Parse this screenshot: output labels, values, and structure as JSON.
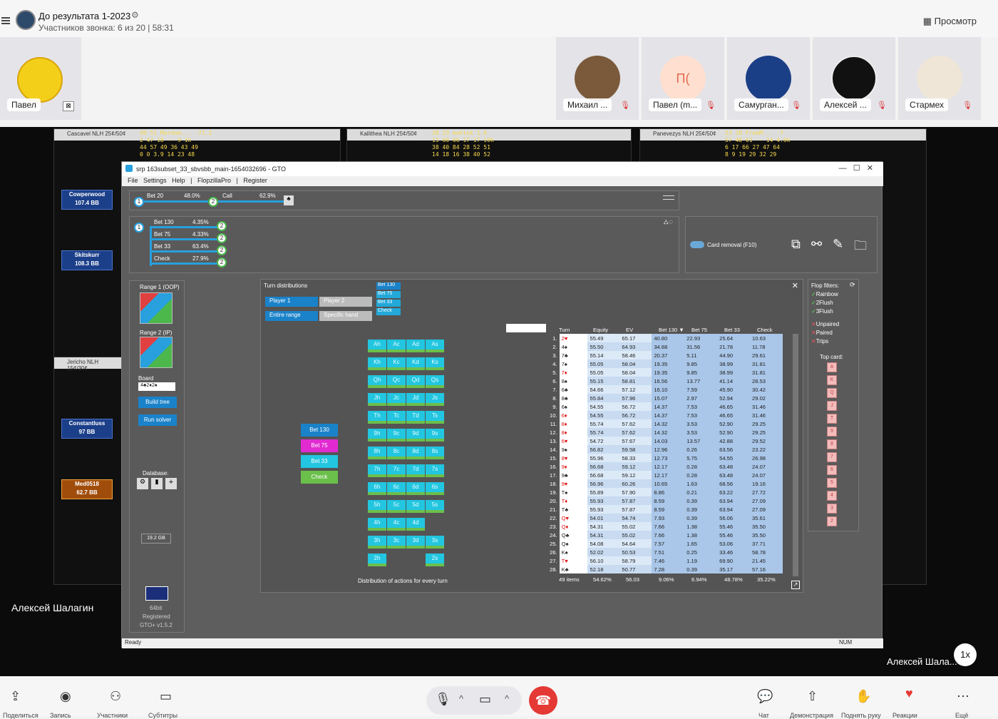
{
  "call": {
    "title": "До результата 1-2023",
    "subtitle": "Участников звонка: 6 из 20 | 58:31",
    "view_label": "Просмотр",
    "self_name": "Павел",
    "participants": [
      {
        "name": "Михаил ...",
        "avatar_text": ""
      },
      {
        "name": "Павел (m...",
        "avatar_text": "П("
      },
      {
        "name": "Самурган...",
        "avatar_text": ""
      },
      {
        "name": "Алексей ...",
        "avatar_text": ""
      },
      {
        "name": "Стармех",
        "avatar_text": ""
      }
    ],
    "presenter": "Алексей Шалагин",
    "presenter_short": "Алексей Шала...",
    "speed_label": "1x"
  },
  "bg_tables": [
    {
      "title": "Cascavel NLH 25¢/50¢",
      "hud": "49 51 Mardum... -71.2\n2 47 18 -- 9 1k\n44 57 49 36 43 49\n0 0 3.9 14 23 48"
    },
    {
      "title": "Kallithea NLH 25¢/50¢",
      "hud": "28 23 moklok 1.6\n13 66 66 17 17 10k\n38 40 84 28 52 51\n14 18 16 38 40 52"
    },
    {
      "title": "Panevezys NLH 25¢/50¢",
      "hud": "23 18 FreeM... -7\n57 48 61 -- 14 4.6k\n6 17 66 27 47 64\n8 9 19 29 32 29"
    },
    {
      "title": "Jericho NLH 15¢/30¢",
      "hud": ""
    }
  ],
  "bg_players": [
    {
      "name": "Cowperwood",
      "stack": "107.4 BB"
    },
    {
      "name": "Skitskurr",
      "stack": "108.3 BB"
    },
    {
      "name": "Constantluss",
      "stack": "97 BB"
    },
    {
      "name": "Med0518",
      "stack": "62.7 BB"
    }
  ],
  "gto": {
    "window_title": "srp 163subset_33_sbvsbb_main-1654032696 - GTO",
    "menu": [
      "File",
      "Settings",
      "Help",
      "|",
      "FlopzillaPro",
      "|",
      "Register"
    ],
    "line_actions": [
      {
        "label": "Bet 20",
        "pct": "48.0%"
      },
      {
        "label": "Call",
        "pct": "62.9%"
      }
    ],
    "tree_actions": [
      {
        "label": "Bet 130",
        "pct": "4.35%"
      },
      {
        "label": "Bet 75",
        "pct": "4.33%"
      },
      {
        "label": "Bet 33",
        "pct": "63.4%"
      },
      {
        "label": "Check",
        "pct": "27.9%"
      }
    ],
    "card_removal": "Card removal (F10)",
    "range1": "Range 1 (OOP)",
    "range2": "Range 2 (IP)",
    "board_label": "Board",
    "board_value": "4♣2♦2♠",
    "build_tree": "Build tree",
    "run_solver": "Run solver",
    "database": "Database:",
    "memory": "19.2 GB",
    "bits": "64bit",
    "registered": "Registered",
    "version": "GTO+ v1.5.2",
    "status": "Ready",
    "num": "NUM",
    "turn_dist": {
      "title": "Turn distributions",
      "player1": "Player 1",
      "player2": "Player 2",
      "entire_range": "Entire range",
      "specific_hand": "Specific hand",
      "legend": [
        "Bet 130",
        "Bet 75",
        "Bet 33",
        "Check"
      ],
      "footer": "Distribution of actions for every turn",
      "cards": [
        [
          "Ah",
          "Ac",
          "Ad",
          "As"
        ],
        [
          "Kh",
          "Kc",
          "Kd",
          "Ks"
        ],
        [
          "Qh",
          "Qc",
          "Qd",
          "Qs"
        ],
        [
          "Jh",
          "Jc",
          "Jd",
          "Js"
        ],
        [
          "Th",
          "Tc",
          "Td",
          "Ts"
        ],
        [
          "9h",
          "9c",
          "9d",
          "9s"
        ],
        [
          "8h",
          "8c",
          "8d",
          "8s"
        ],
        [
          "7h",
          "7c",
          "7d",
          "7s"
        ],
        [
          "6h",
          "6c",
          "6d",
          "6s"
        ],
        [
          "5h",
          "5c",
          "5d",
          "5s"
        ],
        [
          "4h",
          "4c",
          "4d",
          ""
        ],
        [
          "3h",
          "3c",
          "3d",
          "3s"
        ],
        [
          "2h",
          "",
          "",
          "2s"
        ]
      ],
      "action_buttons": [
        {
          "label": "Bet 130",
          "color": "#1a82c9"
        },
        {
          "label": "Bet 75",
          "color": "#e12bd1"
        },
        {
          "label": "Bet 33",
          "color": "#22c6e0"
        },
        {
          "label": "Check",
          "color": "#6bc04b"
        }
      ]
    },
    "table": {
      "headers": [
        "Turn",
        "Equity",
        "EV",
        "Bet 130 ▼",
        "Bet 75",
        "Bet 33",
        "Check"
      ],
      "rows": [
        [
          "1.",
          "2♥",
          "55.49",
          "65.17",
          "40.80",
          "22.93",
          "25.64",
          "10.63"
        ],
        [
          "2.",
          "4♠",
          "55.50",
          "64.93",
          "34.88",
          "31.56",
          "21.78",
          "11.78"
        ],
        [
          "3.",
          "7♣",
          "55.14",
          "58.46",
          "20.37",
          "5.11",
          "44.90",
          "29.61"
        ],
        [
          "4.",
          "7♠",
          "55.05",
          "58.04",
          "19.35",
          "9.85",
          "38.99",
          "31.81"
        ],
        [
          "5.",
          "7♦",
          "55.05",
          "58.04",
          "19.35",
          "9.85",
          "38.99",
          "31.81"
        ],
        [
          "6.",
          "8♠",
          "55.15",
          "58.81",
          "16.56",
          "13.77",
          "41.14",
          "28.53"
        ],
        [
          "7.",
          "6♣",
          "54.66",
          "57.12",
          "16.10",
          "7.59",
          "45.90",
          "30.42"
        ],
        [
          "8.",
          "8♣",
          "55.84",
          "57.96",
          "15.07",
          "2.97",
          "52.94",
          "29.02"
        ],
        [
          "9.",
          "6♠",
          "54.55",
          "56.72",
          "14.37",
          "7.53",
          "46.65",
          "31.46"
        ],
        [
          "10.",
          "6♦",
          "54.55",
          "56.72",
          "14.37",
          "7.53",
          "46.65",
          "31.46"
        ],
        [
          "11.",
          "8♦",
          "55.74",
          "57.62",
          "14.32",
          "3.53",
          "52.90",
          "29.25"
        ],
        [
          "12.",
          "8♦",
          "55.74",
          "57.62",
          "14.32",
          "3.53",
          "52.90",
          "29.25"
        ],
        [
          "13.",
          "6♥",
          "54.72",
          "57.67",
          "14.03",
          "13.57",
          "42.88",
          "29.52"
        ],
        [
          "14.",
          "9♠",
          "56.82",
          "59.58",
          "12.96",
          "0.26",
          "63.56",
          "23.22"
        ],
        [
          "15.",
          "8♥",
          "55.96",
          "58.33",
          "12.73",
          "5.75",
          "54.55",
          "26.98"
        ],
        [
          "16.",
          "9♦",
          "56.68",
          "59.12",
          "12.17",
          "0.28",
          "63.48",
          "24.07"
        ],
        [
          "17.",
          "9♣",
          "56.68",
          "59.12",
          "12.17",
          "0.28",
          "63.48",
          "24.07"
        ],
        [
          "18.",
          "9♥",
          "56.96",
          "60.26",
          "10.65",
          "1.63",
          "68.56",
          "19.16"
        ],
        [
          "19.",
          "T♠",
          "55.89",
          "57.90",
          "8.86",
          "0.21",
          "63.22",
          "27.72"
        ],
        [
          "20.",
          "T♦",
          "55.93",
          "57.87",
          "8.59",
          "0.39",
          "63.94",
          "27.09"
        ],
        [
          "21.",
          "T♣",
          "55.93",
          "57.87",
          "8.59",
          "0.39",
          "63.94",
          "27.09"
        ],
        [
          "22.",
          "Q♥",
          "54.01",
          "54.74",
          "7.93",
          "0.39",
          "56.06",
          "35.61"
        ],
        [
          "23.",
          "Q♦",
          "54.31",
          "55.02",
          "7.66",
          "1.38",
          "55.46",
          "35.50"
        ],
        [
          "24.",
          "Q♣",
          "54.31",
          "55.02",
          "7.66",
          "1.38",
          "55.46",
          "35.50"
        ],
        [
          "25.",
          "Q♠",
          "54.08",
          "54.64",
          "7.57",
          "1.65",
          "53.06",
          "37.71"
        ],
        [
          "26.",
          "K♠",
          "52.02",
          "50.53",
          "7.51",
          "0.25",
          "33.46",
          "58.78"
        ],
        [
          "27.",
          "T♥",
          "56.10",
          "58.79",
          "7.46",
          "1.19",
          "69.90",
          "21.45"
        ],
        [
          "28.",
          "K♣",
          "52.18",
          "50.77",
          "7.28",
          "0.39",
          "35.17",
          "57.16"
        ]
      ],
      "footer": [
        "49 items",
        "54.62%",
        "56.03",
        "9.06%",
        "6.94%",
        "48.78%",
        "35.22%"
      ]
    },
    "filters": {
      "title": "Flop filters:",
      "checked": [
        "Rainbow",
        "2Flush",
        "3Flush"
      ],
      "crossed": [
        "Unpaired",
        "Paired",
        "Trips"
      ],
      "top_card": "Top card:",
      "top_cards": [
        "A",
        "K",
        "Q",
        "J",
        "T",
        "9",
        "8",
        "7",
        "6",
        "5",
        "4",
        "3",
        "2"
      ]
    }
  },
  "bottom": {
    "labels": [
      "Поделиться",
      "Запись",
      "Участники",
      "Субтитры",
      "Чат",
      "Демонстрация",
      "Поднять руку",
      "Реакции",
      "Ещё"
    ]
  }
}
